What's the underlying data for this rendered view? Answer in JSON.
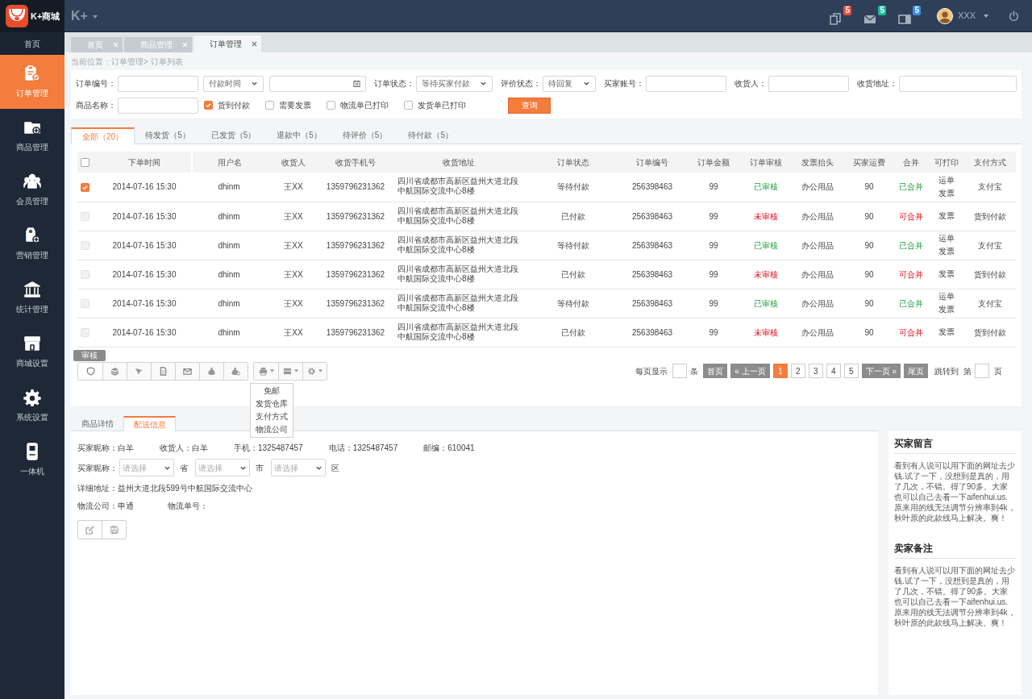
{
  "app": {
    "logo_text": "K+商城",
    "brand": "K+"
  },
  "sidebar": {
    "items": [
      {
        "label": "首页",
        "selected": false,
        "kind": "plain"
      },
      {
        "label": "订单管理",
        "selected": true,
        "kind": "icon"
      },
      {
        "label": "商品管理",
        "selected": false,
        "kind": "icon"
      },
      {
        "label": "会员管理",
        "selected": false,
        "kind": "icon"
      },
      {
        "label": "营销管理",
        "selected": false,
        "kind": "icon"
      },
      {
        "label": "统计管理",
        "selected": false,
        "kind": "icon"
      },
      {
        "label": "商城设置",
        "selected": false,
        "kind": "icon"
      },
      {
        "label": "系统设置",
        "selected": false,
        "kind": "icon"
      },
      {
        "label": "一体机",
        "selected": false,
        "kind": "icon"
      }
    ]
  },
  "topbar": {
    "notifications": [
      {
        "count": "5",
        "color": "#e84c3d"
      },
      {
        "count": "5",
        "color": "#1abc9c"
      },
      {
        "count": "5",
        "color": "#3a8ee6"
      }
    ],
    "user": "XXX"
  },
  "page_tabs": [
    {
      "label": "首页",
      "selected": false
    },
    {
      "label": "商品管理",
      "selected": false
    },
    {
      "label": "订单管理",
      "selected": true
    }
  ],
  "breadcrumb": "当前位置：订单管理> 订单列表",
  "filters": [
    [
      {
        "kind": "input",
        "label": "订单编号："
      },
      {
        "kind": "select",
        "value": "付款时间"
      },
      {
        "kind": "date"
      },
      {
        "kind": "select",
        "label": "订单状态：",
        "value": "等待买家付款"
      },
      {
        "kind": "select",
        "label": "评价状态：",
        "value": "待回复"
      },
      {
        "kind": "input",
        "label": "买家账号："
      },
      {
        "kind": "input",
        "label": "收货人："
      },
      {
        "kind": "input",
        "label": "收货地址："
      }
    ],
    [
      {
        "kind": "input",
        "label": "商品名称："
      },
      {
        "kind": "checkbox",
        "label": "货到付款",
        "checked": true
      },
      {
        "kind": "checkbox",
        "label": "需要发票",
        "checked": false
      },
      {
        "kind": "checkbox",
        "label": "物流单已打印",
        "checked": false
      },
      {
        "kind": "checkbox",
        "label": "发货单已打印",
        "checked": false
      },
      {
        "kind": "button",
        "label": "查询"
      }
    ]
  ],
  "status_tabs": [
    {
      "label": "全部（20）",
      "selected": true
    },
    {
      "label": "待发货（5）",
      "selected": false
    },
    {
      "label": "已发货（5）",
      "selected": false
    },
    {
      "label": "退款中（5）",
      "selected": false
    },
    {
      "label": "待评价（5）",
      "selected": false
    },
    {
      "label": "待付款（5）",
      "selected": false
    }
  ],
  "table": {
    "header_checked": false,
    "columns": [
      "下单时间",
      "用户名",
      "收货人",
      "收货手机号",
      "收货地址",
      "订单状态",
      "订单编号",
      "订单金额",
      "订单审核",
      "发票抬头",
      "买家运费",
      "合并",
      "可打印",
      "支付方式"
    ],
    "rows": [
      {
        "checked": true,
        "time": "2014-07-16 15:30",
        "user": "dhinm",
        "receiver": "王XX",
        "phone": "1359796231362",
        "address": "四川省成都市高新区益州大道北段中航国际交流中心8楼",
        "status": "等待付款",
        "order_no": "256398463",
        "amount": "99",
        "audit": {
          "text": "已审核",
          "approved": true
        },
        "invoice_title": "办公用品",
        "freight": "90",
        "merge": {
          "text": "已合并",
          "merged": true
        },
        "printable": [
          "运单",
          "发票"
        ],
        "payment": "支付宝"
      },
      {
        "checked": false,
        "time": "2014-07-16 15:30",
        "user": "dhinm",
        "receiver": "王XX",
        "phone": "1359796231362",
        "address": "四川省成都市高新区益州大道北段中航国际交流中心8楼",
        "status": "已付款",
        "order_no": "256398463",
        "amount": "99",
        "audit": {
          "text": "未审核",
          "approved": false
        },
        "invoice_title": "办公用品",
        "freight": "90",
        "merge": {
          "text": "可合并",
          "merged": false
        },
        "printable": [
          "发票"
        ],
        "payment": "货到付款"
      },
      {
        "checked": false,
        "time": "2014-07-16 15:30",
        "user": "dhinm",
        "receiver": "王XX",
        "phone": "1359796231362",
        "address": "四川省成都市高新区益州大道北段中航国际交流中心8楼",
        "status": "等待付款",
        "order_no": "256398463",
        "amount": "99",
        "audit": {
          "text": "已审核",
          "approved": true
        },
        "invoice_title": "办公用品",
        "freight": "90",
        "merge": {
          "text": "已合并",
          "merged": true
        },
        "printable": [
          "运单",
          "发票"
        ],
        "payment": "支付宝"
      },
      {
        "checked": false,
        "time": "2014-07-16 15:30",
        "user": "dhinm",
        "receiver": "王XX",
        "phone": "1359796231362",
        "address": "四川省成都市高新区益州大道北段中航国际交流中心8楼",
        "status": "已付款",
        "order_no": "256398463",
        "amount": "99",
        "audit": {
          "text": "未审核",
          "approved": false
        },
        "invoice_title": "办公用品",
        "freight": "90",
        "merge": {
          "text": "可合并",
          "merged": false
        },
        "printable": [
          "发票"
        ],
        "payment": "货到付款"
      },
      {
        "checked": false,
        "time": "2014-07-16 15:30",
        "user": "dhinm",
        "receiver": "王XX",
        "phone": "1359796231362",
        "address": "四川省成都市高新区益州大道北段中航国际交流中心8楼",
        "status": "等待付款",
        "order_no": "256398463",
        "amount": "99",
        "audit": {
          "text": "已审核",
          "approved": true
        },
        "invoice_title": "办公用品",
        "freight": "90",
        "merge": {
          "text": "已合并",
          "merged": true
        },
        "printable": [
          "运单",
          "发票"
        ],
        "payment": "支付宝"
      },
      {
        "checked": false,
        "time": "2014-07-16 15:30",
        "user": "dhinm",
        "receiver": "王XX",
        "phone": "1359796231362",
        "address": "四川省成都市高新区益州大道北段中航国际交流中心8楼",
        "status": "已付款",
        "order_no": "256398463",
        "amount": "99",
        "audit": {
          "text": "未审核",
          "approved": false
        },
        "invoice_title": "办公用品",
        "freight": "90",
        "merge": {
          "text": "可合并",
          "merged": false
        },
        "printable": [
          "发票"
        ],
        "payment": "货到付款"
      }
    ]
  },
  "toolbar": {
    "tooltip": "审核",
    "menu": [
      "免邮",
      "发货仓库",
      "支付方式",
      "物流公司"
    ]
  },
  "pagination": {
    "per_page_label": "每页显示",
    "per_page_unit": "条",
    "first": {
      "label": "首页",
      "disabled": true
    },
    "prev": {
      "label": "« 上一页",
      "disabled": true
    },
    "pages": [
      {
        "label": "1",
        "selected": true
      },
      {
        "label": "2",
        "selected": false
      },
      {
        "label": "3",
        "selected": false
      },
      {
        "label": "4",
        "selected": false
      },
      {
        "label": "5",
        "selected": false
      }
    ],
    "next": {
      "label": "下一页 »",
      "disabled": true
    },
    "last": {
      "label": "尾页",
      "disabled": true
    },
    "jump_label": "跳转到",
    "jump_prefix": "第",
    "jump_suffix": "页"
  },
  "detail_tabs": [
    {
      "label": "商品详情",
      "selected": false
    },
    {
      "label": "配送信息",
      "selected": true
    }
  ],
  "shipping": {
    "info": [
      "买家昵称：白羊",
      "收货人：白羊",
      "手机：1325487457",
      "电话：1325487457",
      "邮编：610041"
    ],
    "region_label": "买家昵称：",
    "regions": [
      {
        "placeholder": "请选择",
        "suffix": "省"
      },
      {
        "placeholder": "请选择",
        "suffix": "市"
      },
      {
        "placeholder": "请选择",
        "suffix": "区"
      }
    ],
    "address": "详细地址：益州大道北段599号中航国际交流中心",
    "logistics": [
      "物流公司：申通",
      "物流单号："
    ]
  },
  "notes": [
    {
      "title": "买家留言",
      "body": "看到有人说可以用下面的网址去少钱.试了一下，没想到是真的，用了几次，不错。得了90多。大家也可以自己去看一下aifenhui.us.原来用的线无法调节分辨率到4k，秋叶原的此款线马上解决。爽！"
    },
    {
      "title": "卖家备注",
      "body": "看到有人说可以用下面的网址去少钱.试了一下，没想到是真的，用了几次，不错。得了90多。大家也可以自己去看一下aifenhui.us.原来用的线无法调节分辨率到4k，秋叶原的此款线马上解决。爽！"
    }
  ]
}
